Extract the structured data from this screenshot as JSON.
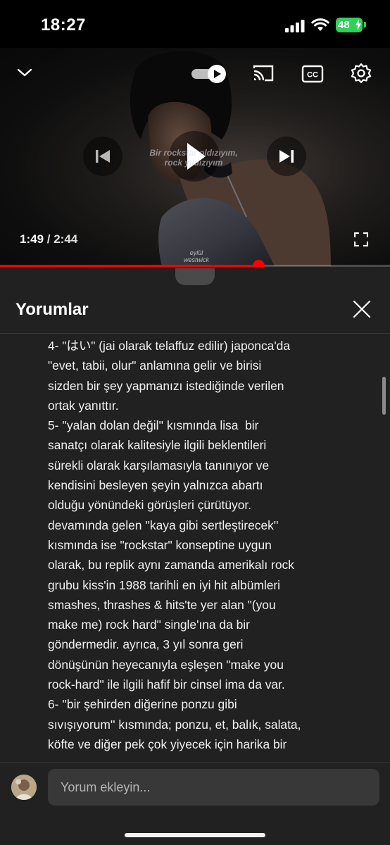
{
  "status_bar": {
    "time": "18:27",
    "battery": "48",
    "icons": [
      "signal-icon",
      "wifi-icon",
      "battery-charging-icon"
    ]
  },
  "player": {
    "current_time": "1:49",
    "separator": " / ",
    "duration": "2:44",
    "progress_fraction": 0.663,
    "subtitle_lines": [
      "Bir rockstar oldızıyım,",
      "rock yıldızıyım"
    ],
    "watermark_lines": [
      "eylül",
      "westwick"
    ],
    "icons": [
      "chevron-down-icon",
      "autoplay-toggle",
      "cast-icon",
      "cc-icon",
      "gear-icon",
      "previous-icon",
      "play-icon",
      "next-icon",
      "fullscreen-icon"
    ],
    "progress_color": "#ff0000"
  },
  "comments": {
    "title": "Yorumlar",
    "lines": [
      "4- \"はい\" (jai olarak telaffuz edilir) japonca'da",
      "\"evet, tabii, olur\" anlamına gelir ve birisi",
      "sizden bir şey yapmanızı istediğinde verilen",
      "ortak yanıttır.",
      "5- ''yalan dolan değil'' kısmında lisa  bir",
      "sanatçı olarak kalitesiyle ilgili beklentileri",
      "sürekli olarak karşılamasıyla tanınıyor ve",
      "kendisini besleyen şeyin yalnızca abartı",
      "olduğu yönündeki görüşleri çürütüyor.",
      "devamında gelen ''kaya gibi sertleştirecek''",
      "kısmında ise \"rockstar\" konseptine uygun",
      "olarak, bu replik aynı zamanda amerikalı rock",
      "grubu kiss'in 1988 tarihli en iyi hit albümleri",
      "smashes, thrashes & hits'te yer alan \"(you",
      "make me) rock hard\" single'ına da bir",
      "göndermedir. ayrıca, 3 yıl sonra geri",
      "dönüşünün heyecanıyla eşleşen \"make you",
      "rock-hard\" ile ilgili hafif bir cinsel ima da var.",
      "6- ''bir şehirden diğerine ponzu gibi",
      "sıvışıyorum'' kısmında; ponzu, et, balık, salata,",
      "köfte ve diğer pek çok yiyecek için harika bir"
    ],
    "input_placeholder": "Yorum ekleyin..."
  }
}
